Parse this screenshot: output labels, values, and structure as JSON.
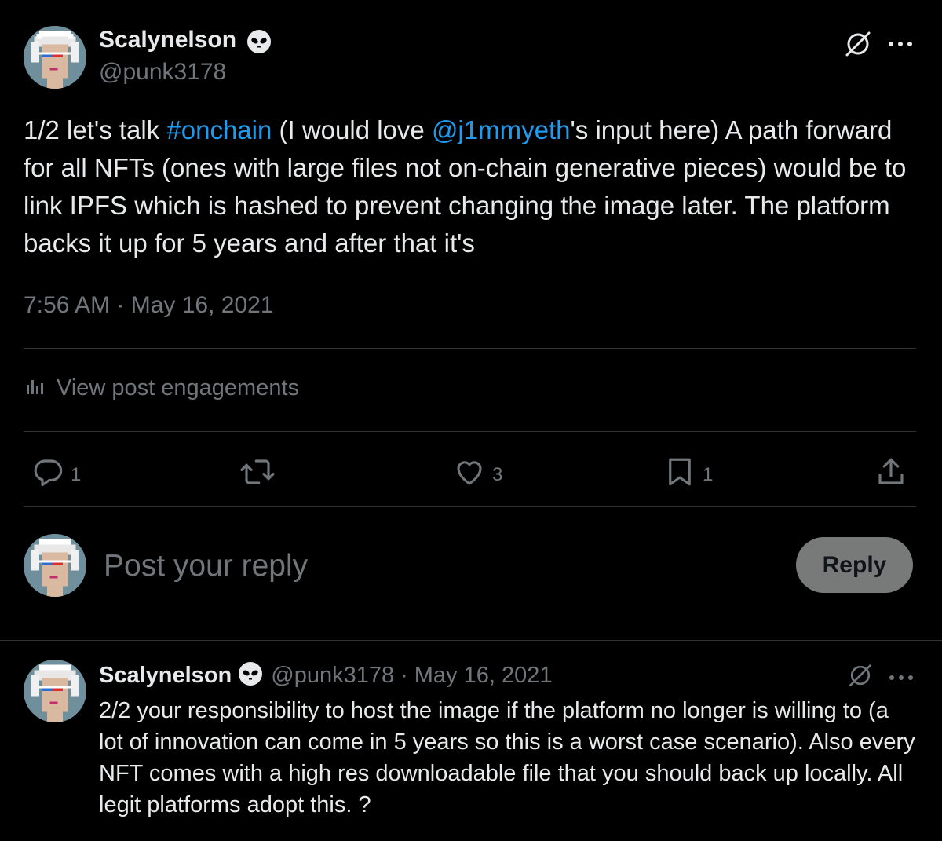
{
  "main_post": {
    "author_name": "Scalynelson",
    "author_handle": "@punk3178",
    "text_part1": "1/2 let's talk ",
    "hashtag": "#onchain",
    "text_part2": " (I would love ",
    "mention": "@j1mmyeth",
    "text_part3": "'s input here)  A path forward for all NFTs (ones with large files not on-chain generative pieces) would be to link IPFS which is hashed to prevent changing the image later. The platform backs it up for 5 years and after that it's",
    "timestamp": "7:56 AM · May 16, 2021",
    "engagements_label": "View post engagements",
    "reply_count": "1",
    "repost_count": "",
    "like_count": "3",
    "bookmark_count": "1"
  },
  "composer": {
    "placeholder": "Post your reply",
    "button_label": "Reply"
  },
  "reply_post": {
    "author_name": "Scalynelson",
    "author_handle": "@punk3178",
    "separator": "·",
    "date": "May 16, 2021",
    "text": "2/2 your responsibility to host the image if the platform no longer is willing to (a lot of innovation can come in 5 years so this is a worst case scenario). Also every NFT comes with a high res downloadable file that you should back up locally. All legit platforms adopt this. ?"
  },
  "icons": {
    "verified": "alien-icon",
    "grok": "grok-icon",
    "more": "more-icon",
    "analytics": "analytics-icon",
    "reply": "reply-icon",
    "repost": "repost-icon",
    "like": "heart-icon",
    "bookmark": "bookmark-icon",
    "share": "share-icon"
  },
  "colors": {
    "background": "#000000",
    "text": "#e7e9ea",
    "muted": "#71767b",
    "link": "#1d9bf0",
    "divider": "#2f3336",
    "reply_button": "#787a7a"
  }
}
